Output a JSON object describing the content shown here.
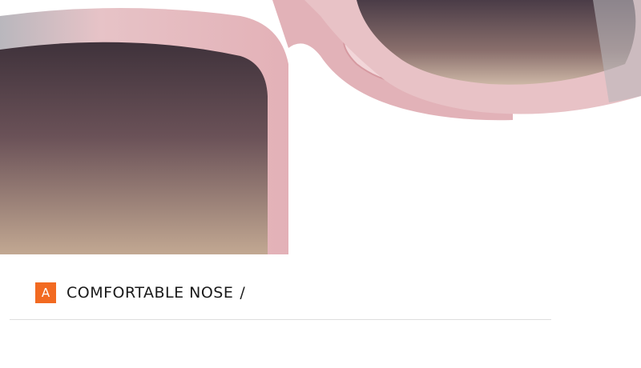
{
  "feature": {
    "badge_letter": "A",
    "title": "COMFORTABLE NOSE",
    "separator": "/"
  },
  "colors": {
    "badge": "#f26a21",
    "frame": "#e8b8bd",
    "lens_top": "#4a3b45",
    "lens_bottom": "#b89f8c"
  }
}
